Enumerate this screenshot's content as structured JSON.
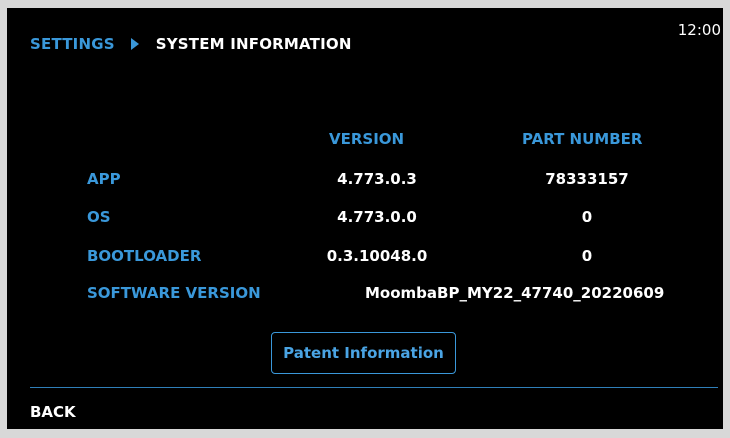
{
  "header": {
    "breadcrumb_root": "SETTINGS",
    "breadcrumb_current": "SYSTEM INFORMATION",
    "clock": "12:00"
  },
  "table": {
    "columns": [
      "VERSION",
      "PART NUMBER"
    ],
    "rows": [
      {
        "label": "APP",
        "version": "4.773.0.3",
        "part_number": "78333157"
      },
      {
        "label": "OS",
        "version": "4.773.0.0",
        "part_number": "0"
      },
      {
        "label": "BOOTLOADER",
        "version": "0.3.10048.0",
        "part_number": "0"
      }
    ],
    "software_version": {
      "label": "SOFTWARE VERSION",
      "value": "MoombaBP_MY22_47740_20220609"
    }
  },
  "actions": {
    "patent_label": "Patent Information",
    "back_label": "BACK"
  },
  "colors": {
    "accent": "#3a98da",
    "background": "#000000",
    "text": "#ffffff"
  }
}
